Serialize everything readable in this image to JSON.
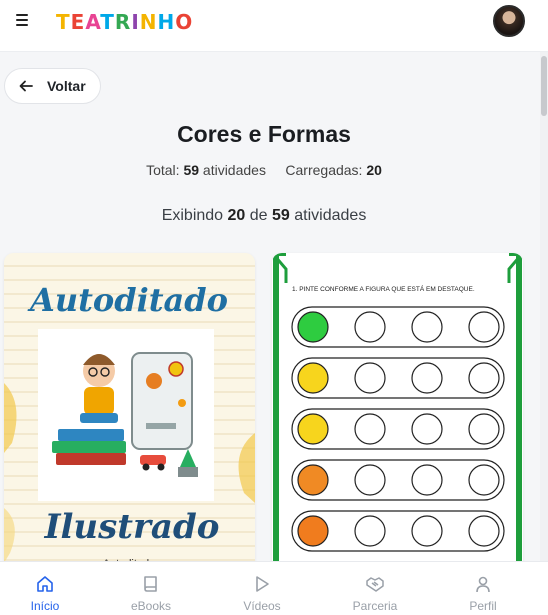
{
  "app": {
    "logo_letters": [
      {
        "char": "T",
        "color": "#f4b400"
      },
      {
        "char": "E",
        "color": "#ea4335"
      },
      {
        "char": "A",
        "color": "#e84393"
      },
      {
        "char": "T",
        "color": "#00a8e8"
      },
      {
        "char": "R",
        "color": "#34a853"
      },
      {
        "char": "I",
        "color": "#8e44ad"
      },
      {
        "char": "N",
        "color": "#f4b400"
      },
      {
        "char": "H",
        "color": "#00a8e8"
      },
      {
        "char": "O",
        "color": "#ea4335"
      }
    ]
  },
  "header": {
    "menu_icon": "hamburger-icon",
    "avatar_icon": "user-avatar"
  },
  "back_button": {
    "label": "Voltar",
    "icon": "arrow-left-icon"
  },
  "page": {
    "title": "Cores e Formas",
    "total_label": "Total:",
    "total_value": "59",
    "total_suffix": "atividades",
    "loaded_label": "Carregadas:",
    "loaded_value": "20",
    "showing_prefix": "Exibindo",
    "showing_count": "20",
    "showing_of": "de",
    "showing_total": "59",
    "showing_suffix": "atividades"
  },
  "cards": [
    {
      "title_top": "Autoditado",
      "title_bottom": "Ilustrado",
      "caption": "Autoditado"
    },
    {
      "instruction": "1. PINTE CONFORME A FIGURA QUE ESTÁ EM DESTAQUE."
    }
  ],
  "bottom_nav": [
    {
      "label": "Início",
      "icon": "home-icon",
      "active": true
    },
    {
      "label": "eBooks",
      "icon": "book-icon",
      "active": false
    },
    {
      "label": "Vídeos",
      "icon": "play-icon",
      "active": false
    },
    {
      "label": "Parceria",
      "icon": "handshake-icon",
      "active": false
    },
    {
      "label": "Perfil",
      "icon": "user-icon",
      "active": false
    }
  ],
  "colors": {
    "accent": "#2563eb",
    "inactive": "#9aa0a8",
    "worksheet_green": "#1e9e3c"
  }
}
